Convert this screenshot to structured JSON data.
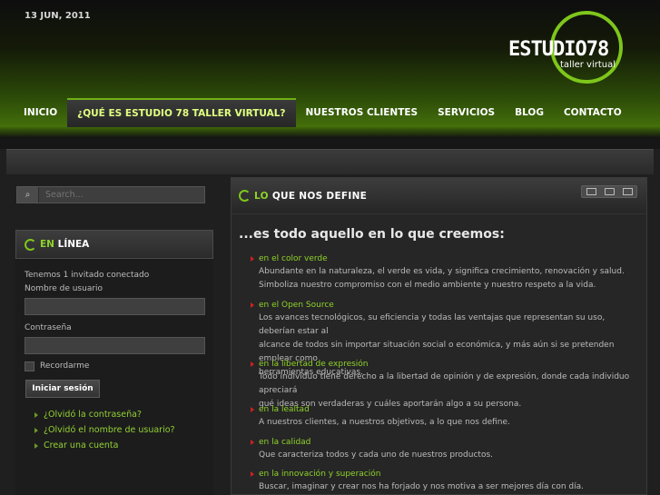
{
  "header": {
    "date": "13 JUN, 2011",
    "logo_word": "ESTUDIO78",
    "logo_sub": "taller virtual"
  },
  "nav": {
    "items": [
      {
        "label": "INICIO"
      },
      {
        "label": "¿QUÉ ES ESTUDIO 78 TALLER VIRTUAL?"
      },
      {
        "label": "NUESTROS CLIENTES"
      },
      {
        "label": "SERVICIOS"
      },
      {
        "label": "BLOG"
      },
      {
        "label": "CONTACTO"
      }
    ],
    "active_index": 1
  },
  "search": {
    "placeholder": "Search..."
  },
  "login_module": {
    "title_accent": "EN",
    "title_rest": "LÍNEA",
    "online_text": "Tenemos 1 invitado conectado",
    "username_label": "Nombre de usuario",
    "password_label": "Contraseña",
    "remember_label": "Recordarme",
    "login_button": "Iniciar sesión",
    "links": [
      "¿Olvidó la contraseña?",
      "¿Olvidó el nombre de usuario?",
      "Crear una cuenta"
    ]
  },
  "article": {
    "title_accent": "LO",
    "title_rest": "QUE NOS DEFINE",
    "headline": "...es todo aquello en lo que creemos:",
    "items": [
      {
        "title": "en el color verde",
        "lines": [
          "Abundante en la naturaleza, el verde es vida, y significa crecimiento, renovación y salud.",
          "Simboliza nuestro compromiso con el medio ambiente y nuestro respeto a la vida."
        ]
      },
      {
        "title": "en el Open Source",
        "lines": [
          "Los avances tecnológicos, su eficiencia y todas las ventajas que representan su uso, deberían estar al",
          "alcance de todos sin importar situación social o económica, y más aún si se pretenden emplear como",
          "herramientas educativas."
        ]
      },
      {
        "title": "en la libertad de expresión",
        "lines": [
          "Todo individuo tiene derecho a la libertad de opinión y de expresión, donde cada individuo apreciará",
          "qué ideas son verdaderas y cuáles aportarán algo a su persona."
        ]
      },
      {
        "title": "en la lealtad",
        "lines": [
          "A nuestros clientes, a nuestros objetivos, a lo que nos define."
        ]
      },
      {
        "title": "en la calidad",
        "lines": [
          "Que caracteriza todos y cada uno de nuestros productos."
        ]
      },
      {
        "title": "en la innovación y superación",
        "lines": [
          "Buscar, imaginar y crear nos ha forjado y nos motiva a ser mejores día con día."
        ]
      }
    ]
  },
  "colors": {
    "accent_green": "#8fd32a",
    "bullet_red": "#cc2222",
    "background": "#1f1f1f"
  }
}
